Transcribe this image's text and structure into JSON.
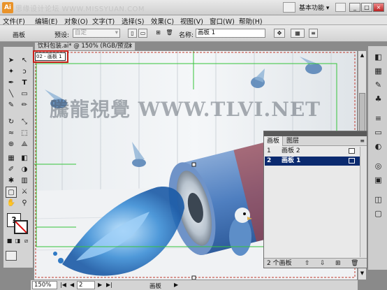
{
  "menubar": {
    "app_logo": "Ai",
    "watermark": "思缘设计论坛  WWW.MISSYUAN.COM",
    "workspace": "基本功能",
    "window_buttons": [
      "_",
      "□",
      "×"
    ]
  },
  "menu": {
    "items": [
      "文件(F)",
      "编辑(E)",
      "对象(O)",
      "文字(T)",
      "选择(S)",
      "效果(C)",
      "视图(V)",
      "窗口(W)",
      "帮助(H)"
    ]
  },
  "control_bar": {
    "tool_name": "画板",
    "preset_label": "预设:",
    "preset_value": "自定",
    "name_label": "名称:",
    "name_value": "画板 1"
  },
  "document": {
    "tab_title": "饮料包装.ai* @ 150% (RGB/预览)",
    "tab_close": "×",
    "artboard_label": "02 - 画板 1",
    "watermark_text": "騰龍視覺 WWW.TLVI.NET"
  },
  "artboards_panel": {
    "tabs": [
      "画板",
      "图层"
    ],
    "rows": [
      {
        "num": "1",
        "name": "画板 2",
        "selected": false
      },
      {
        "num": "2",
        "name": "画板 1",
        "selected": true
      }
    ],
    "footer_count": "2 个画板"
  },
  "status_bar": {
    "zoom": "150%",
    "page": "2",
    "tool": "画板"
  },
  "colors": {
    "selection": "#0b2a6f",
    "highlight_box": "#c8201a",
    "artboard_guide": "#35c43a"
  }
}
